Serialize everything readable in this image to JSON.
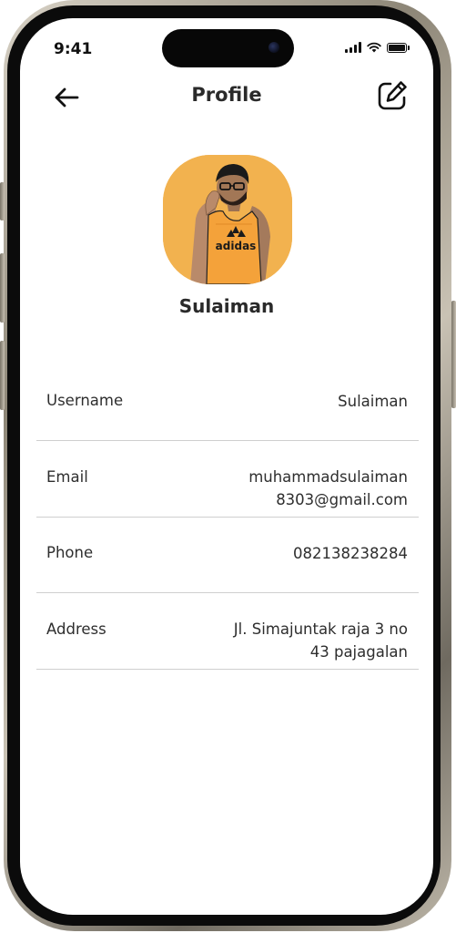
{
  "status_bar": {
    "time": "9:41"
  },
  "header": {
    "title": "Profile"
  },
  "profile": {
    "name": "Sulaiman",
    "avatar_bg": "#f2b24f",
    "shirt_text": "adidas"
  },
  "fields": [
    {
      "label": "Username",
      "value_lines": [
        "Sulaiman"
      ]
    },
    {
      "label": "Email",
      "value_lines": [
        "muhammadsulaiman",
        "8303@gmail.com"
      ]
    },
    {
      "label": "Phone",
      "value_lines": [
        "082138238284"
      ]
    },
    {
      "label": "Address",
      "value_lines": [
        "Jl. Simajuntak raja 3 no",
        "43 pajagalan"
      ]
    }
  ],
  "icons": {
    "back": "arrow-left-icon",
    "edit": "edit-icon"
  }
}
